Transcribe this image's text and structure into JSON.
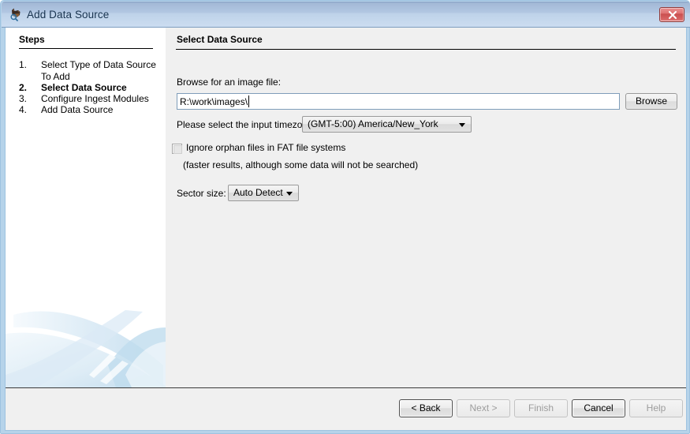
{
  "window": {
    "title": "Add Data Source",
    "icon": "autopsy-dog-icon",
    "close_label": "x",
    "frame_color": "#9ec3e0",
    "titlebar_color": "#b2c7e2"
  },
  "steps": {
    "heading": "Steps",
    "items": [
      {
        "number": "1.",
        "label": "Select Type of Data Source To Add",
        "current": false
      },
      {
        "number": "2.",
        "label": "Select Data Source",
        "current": true
      },
      {
        "number": "3.",
        "label": "Configure Ingest Modules",
        "current": false
      },
      {
        "number": "4.",
        "label": "Add Data Source",
        "current": false
      }
    ]
  },
  "content": {
    "heading": "Select Data Source",
    "browse_label": "Browse for an image file:",
    "path_value": "R:\\work\\images\\",
    "path_placeholder": "",
    "browse_button": "Browse",
    "timezone_label": "Please select the input timezone:",
    "timezone_value": "(GMT-5:00) America/New_York",
    "orphan_checkbox_label": "Ignore orphan files in FAT file systems",
    "orphan_checkbox_checked": false,
    "orphan_hint": "(faster results, although some data will not be searched)",
    "sector_label": "Sector size:",
    "sector_value": "Auto Detect"
  },
  "footer": {
    "back": "< Back",
    "next": "Next >",
    "finish": "Finish",
    "cancel": "Cancel",
    "help": "Help"
  }
}
